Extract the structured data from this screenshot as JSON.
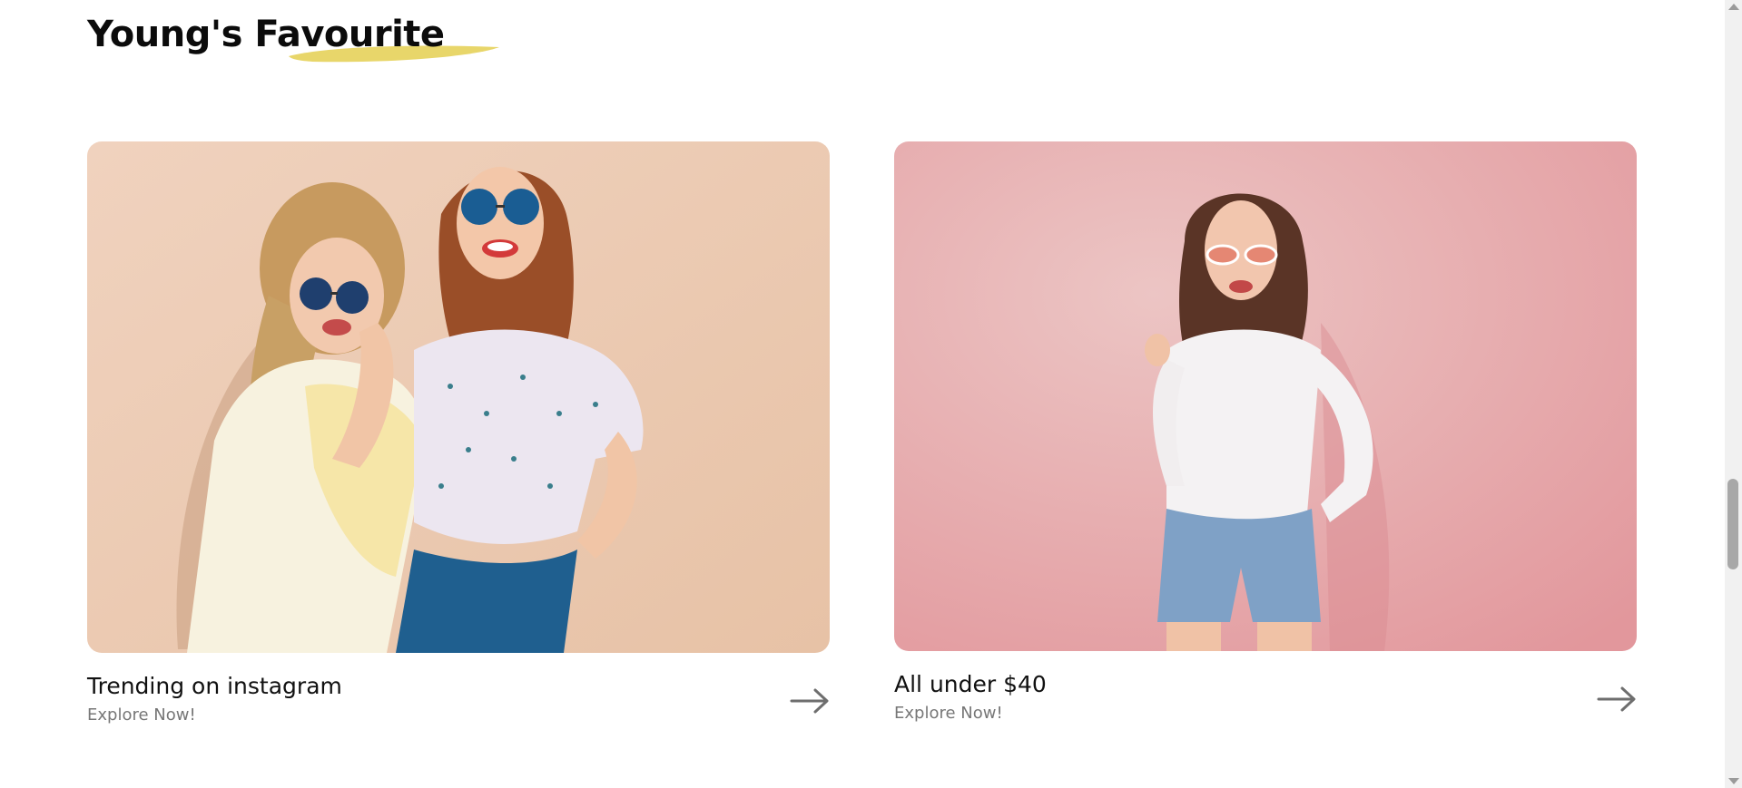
{
  "section": {
    "title": "Young's Favourite",
    "underline_color": "#E8D66A"
  },
  "cards": [
    {
      "title": "Trending on instagram",
      "subtitle": "Explore Now!",
      "image": "two-women-sunglasses-photo",
      "arrow_icon": "arrow-right-icon"
    },
    {
      "title": "All under $40",
      "subtitle": "Explore Now!",
      "image": "woman-pink-background-photo",
      "arrow_icon": "arrow-right-icon"
    }
  ],
  "colors": {
    "title_text": "#0B0B0B",
    "subtitle_text": "#777777",
    "card1_background": "#EBCDB6",
    "card2_background": "#E9A8AC"
  }
}
